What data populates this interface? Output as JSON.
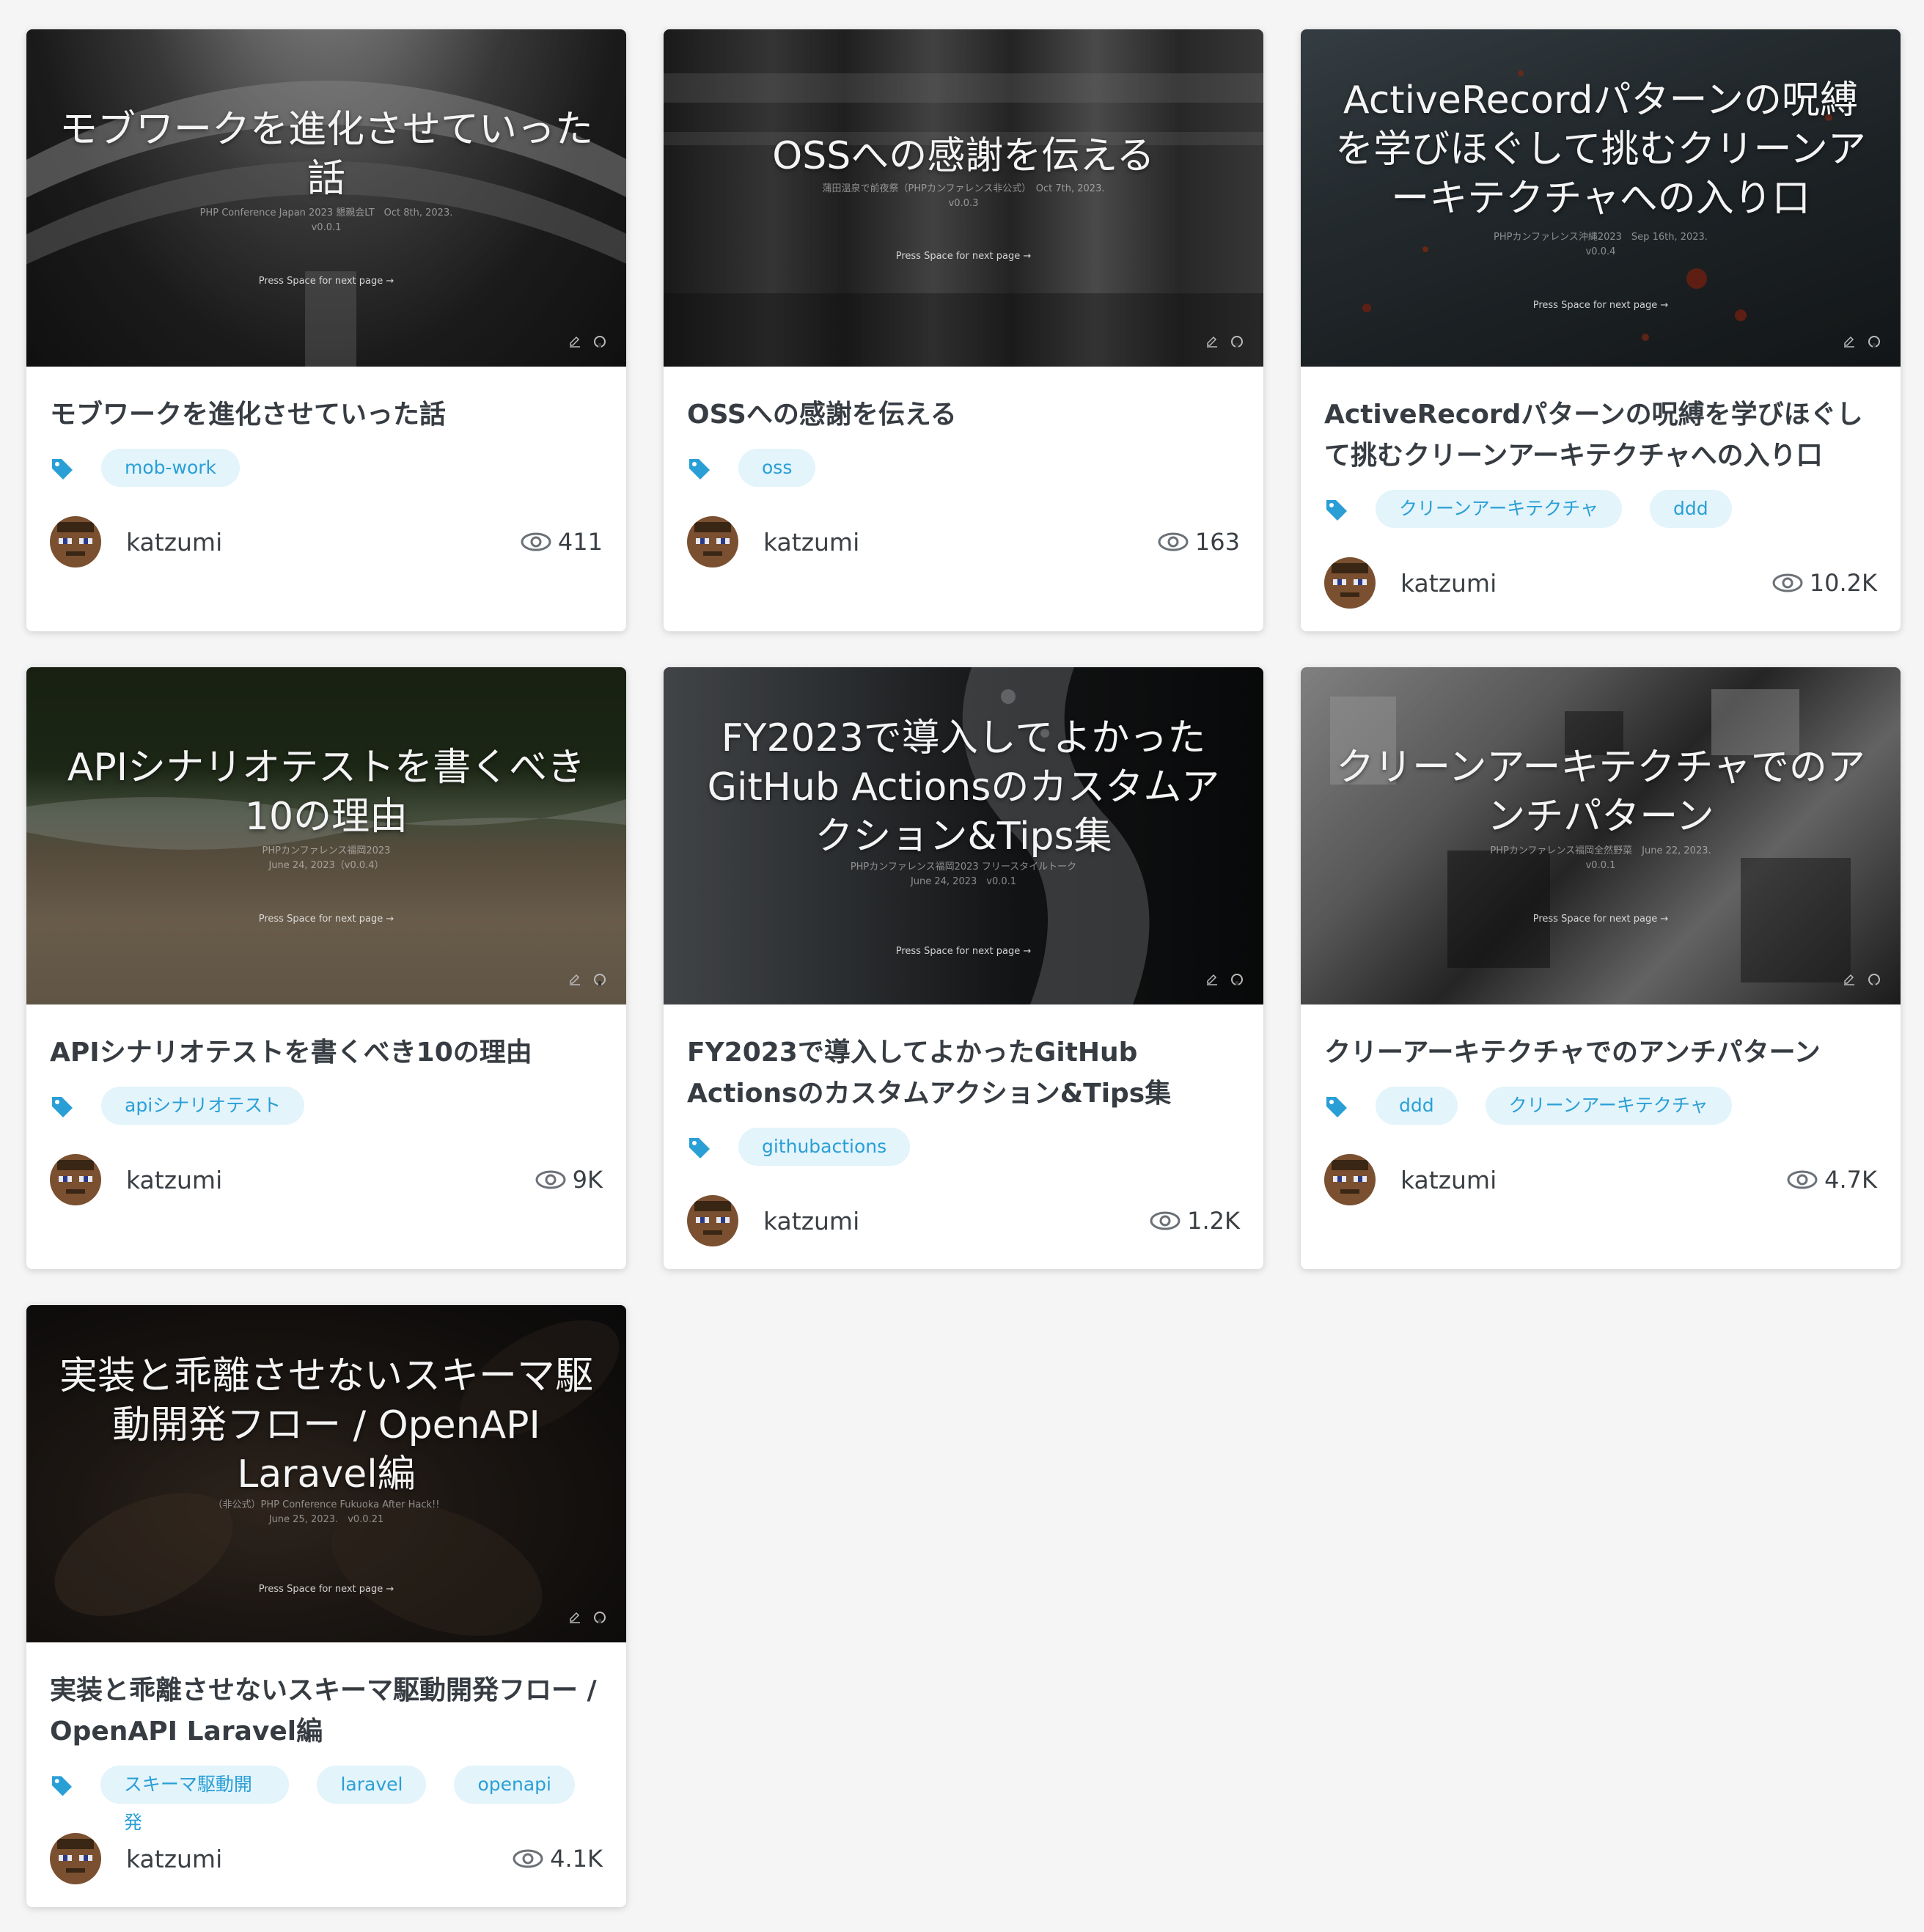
{
  "cards": [
    {
      "slide": {
        "title": "モブワークを進化させていった話",
        "sub1": "PHP Conference Japan 2023 懇親会LT　Oct 8th, 2023.",
        "sub2": "v0.0.1",
        "press": "Press Space for next page →"
      },
      "title": "モブワークを進化させていった話",
      "tags": [
        "mob-work"
      ],
      "author": "katzumi",
      "views": "411"
    },
    {
      "slide": {
        "title": "OSSへの感謝を伝える",
        "sub1": "蒲田温泉で前夜祭（PHPカンファレンス非公式）　Oct 7th, 2023.",
        "sub2": "v0.0.3",
        "press": "Press Space for next page →"
      },
      "title": "OSSへの感謝を伝える",
      "tags": [
        "oss"
      ],
      "author": "katzumi",
      "views": "163"
    },
    {
      "slide": {
        "title": "ActiveRecordパターンの呪縛を学びほぐして挑むクリーンアーキテクチャへの入り口",
        "sub1": "PHPカンファレンス沖縄2023　Sep 16th, 2023.",
        "sub2": "v0.0.4",
        "press": "Press Space for next page →"
      },
      "title": "ActiveRecordパターンの呪縛を学びほぐして挑むクリーンアーキテクチャへの入り口",
      "tags": [
        "クリーンアーキテクチャ",
        "ddd"
      ],
      "author": "katzumi",
      "views": "10.2K"
    },
    {
      "slide": {
        "title": "APIシナリオテストを書くべき10の理由",
        "sub1": "PHPカンファレンス福岡2023",
        "sub2": "June 24, 2023（v0.0.4）",
        "press": "Press Space for next page →"
      },
      "title": "APIシナリオテストを書くべき10の理由",
      "tags": [
        "apiシナリオテスト"
      ],
      "author": "katzumi",
      "views": "9K"
    },
    {
      "slide": {
        "title": "FY2023で導入してよかったGitHub Actionsのカスタムアクション&Tips集",
        "sub1": "PHPカンファレンス福岡2023 フリースタイルトーク",
        "sub2": "June 24, 2023　v0.0.1",
        "press": "Press Space for next page →"
      },
      "title": "FY2023で導入してよかったGitHub Actionsのカスタムアクション&Tips集",
      "tags": [
        "githubactions"
      ],
      "author": "katzumi",
      "views": "1.2K"
    },
    {
      "slide": {
        "title": "クリーンアーキテクチャでのアンチパターン",
        "sub1": "PHPカンファレンス福岡全然野菜　June 22, 2023.",
        "sub2": "v0.0.1",
        "press": "Press Space for next page →"
      },
      "title": "クリーアーキテクチャでのアンチパターン",
      "tags": [
        "ddd",
        "クリーンアーキテクチャ"
      ],
      "author": "katzumi",
      "views": "4.7K"
    },
    {
      "slide": {
        "title": "実装と乖離させないスキーマ駆動開発フロー / OpenAPI Laravel編",
        "sub1": "（非公式）PHP Conference Fukuoka After Hack!!",
        "sub2": "June 25, 2023.　v0.0.21",
        "press": "Press Space for next page →"
      },
      "title": "実装と乖離させないスキーマ駆動開発フロー / OpenAPI Laravel編",
      "tags": [
        "スキーマ駆動開発",
        "laravel",
        "openapi"
      ],
      "author": "katzumi",
      "views": "4.1K"
    }
  ],
  "icons": {
    "tag": "tag-icon",
    "views": "eye-icon",
    "edit": "pencil-icon",
    "github": "github-icon"
  },
  "colors": {
    "tag_bg": "#e3f4fb",
    "tag_text": "#2a9fd6",
    "tag_icon": "#2a9fd6",
    "page_bg": "#f5f5f5"
  }
}
